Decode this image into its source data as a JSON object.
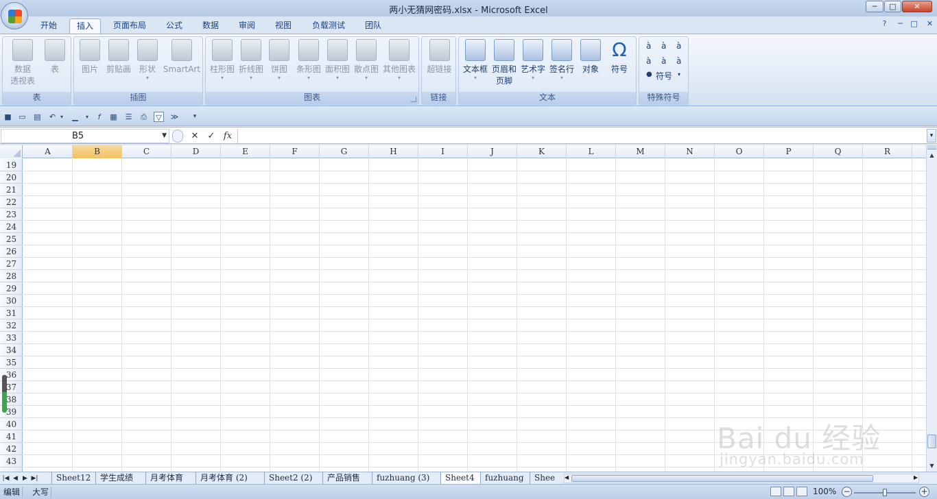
{
  "window": {
    "title": "两小无猜网密码.xlsx - Microsoft Excel",
    "min": "─",
    "max": "□",
    "close": "✕"
  },
  "ribbon_tabs": [
    "开始",
    "插入",
    "页面布局",
    "公式",
    "数据",
    "审阅",
    "视图",
    "负载测试",
    "团队"
  ],
  "ribbon_active_tab": "插入",
  "help_icons": [
    "?",
    "─",
    "□",
    "✕"
  ],
  "groups": {
    "tables": {
      "label": "表",
      "pivot": "数据\n透视表",
      "table": "表"
    },
    "illustrations": {
      "label": "插图",
      "picture": "图片",
      "clipart": "剪贴画",
      "shapes": "形状",
      "smartart": "SmartArt"
    },
    "charts": {
      "label": "图表",
      "column": "柱形图",
      "line": "折线图",
      "pie": "饼图",
      "bar": "条形图",
      "area": "面积图",
      "scatter": "散点图",
      "other": "其他图表"
    },
    "links": {
      "label": "链接",
      "hyperlink": "超链接"
    },
    "text": {
      "label": "文本",
      "textbox": "文本框",
      "header_footer": "页眉和\n页脚",
      "wordart": "艺术字",
      "signature": "签名行",
      "object": "对象",
      "symbol": "符号",
      "symbol_glyph": "Ω"
    },
    "special": {
      "label": "特殊符号",
      "chars": [
        "à",
        "à",
        "à",
        "à",
        "à",
        "à"
      ],
      "symbol_btn": "符号"
    }
  },
  "formula_bar": {
    "name_box": "B5",
    "cancel": "✕",
    "enter": "✓",
    "fx": "fx",
    "value": ""
  },
  "columns": [
    "A",
    "B",
    "C",
    "D",
    "E",
    "F",
    "G",
    "H",
    "I",
    "J",
    "K",
    "L",
    "M",
    "N",
    "O",
    "P",
    "Q",
    "R"
  ],
  "active_column": "B",
  "rows": [
    "19",
    "20",
    "21",
    "22",
    "23",
    "24",
    "25",
    "26",
    "27",
    "28",
    "29",
    "30",
    "31",
    "32",
    "33",
    "34",
    "35",
    "36",
    "37",
    "38",
    "39",
    "40",
    "41",
    "42",
    "43"
  ],
  "sheet_tabs": [
    "Sheet12",
    "学生成绩",
    "月考体育",
    "月考体育 (2)",
    "Sheet2 (2)",
    "产品销售",
    "fuzhuang (3)",
    "Sheet4",
    "fuzhuang",
    "Shee"
  ],
  "active_sheet": "Sheet4",
  "status": {
    "mode": "编辑",
    "caps": "大写",
    "zoom": "100%",
    "zoom_out": "−",
    "zoom_in": "+"
  },
  "watermark": {
    "brand": "Bai du 经验",
    "url": "jingyan.baidu.com"
  }
}
